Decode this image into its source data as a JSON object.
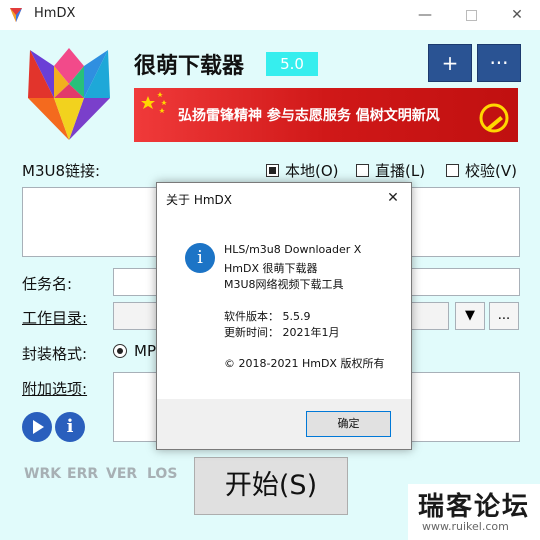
{
  "window": {
    "title": "HmDX"
  },
  "header": {
    "app_name": "很萌下载器",
    "version": "5.0",
    "add_label": "+",
    "more_label": "···"
  },
  "banner": {
    "text": "弘扬雷锋精神 参与志愿服务 倡树文明新风"
  },
  "form": {
    "m3u8_label": "M3U8链接:",
    "local_label": "本地(O)",
    "live_label": "直播(L)",
    "verify_label": "校验(V)",
    "task_label": "任务名:",
    "workdir_label": "工作目录:",
    "format_label": "封装格式:",
    "format_value_partial": "MP",
    "extra_label": "附加选项:",
    "dropdown_glyph": "▼",
    "browse_label": "..."
  },
  "status": {
    "items": [
      "WRK",
      "ERR",
      "VER",
      "LOS"
    ]
  },
  "start_button": {
    "label": "开始(S)"
  },
  "dialog": {
    "title": "关于 HmDX",
    "lines": [
      "HLS/m3u8 Downloader X",
      "HmDX 很萌下载器",
      "M3U8网络视频下载工具"
    ],
    "version": "软件版本： 5.5.9",
    "updated": "更新时间： 2021年1月",
    "copyright": "© 2018-2021 HmDX 版权所有",
    "ok_label": "确定"
  },
  "watermark": {
    "main": "瑞客论坛",
    "sub": "www.ruikel.com"
  },
  "colors": {
    "accent": "#2a5393",
    "version_bg": "#36eeee",
    "banner_red": "#d21e1e",
    "window_bg": "#e1fbfb"
  }
}
